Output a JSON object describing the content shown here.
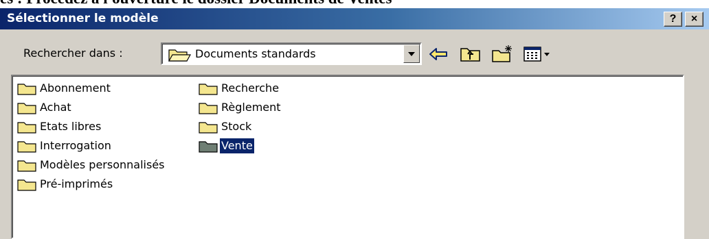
{
  "document_heading": "es : Procédez à l'ouverture le dossier Documents de Ventes",
  "dialog": {
    "title": "Sélectionner le modèle",
    "help_label": "?",
    "close_label": "×"
  },
  "lookin": {
    "label": "Rechercher dans :",
    "value": "Documents standards"
  },
  "files": [
    {
      "label": "Abonnement",
      "selected": false
    },
    {
      "label": "Achat",
      "selected": false
    },
    {
      "label": "Etats libres",
      "selected": false
    },
    {
      "label": "Interrogation",
      "selected": false
    },
    {
      "label": "Modèles personnalisés",
      "selected": false
    },
    {
      "label": "Pré-imprimés",
      "selected": false
    },
    {
      "label": "Recherche",
      "selected": false
    },
    {
      "label": "Règlement",
      "selected": false
    },
    {
      "label": "Stock",
      "selected": false
    },
    {
      "label": "Vente",
      "selected": true
    }
  ],
  "colors": {
    "titlebar_start": "#0a246a",
    "titlebar_end": "#a6caf0",
    "dialog_face": "#d4d0c8",
    "selection": "#0a246a",
    "folder": "#f4e68f",
    "folder_selected": "#6f7f74"
  }
}
